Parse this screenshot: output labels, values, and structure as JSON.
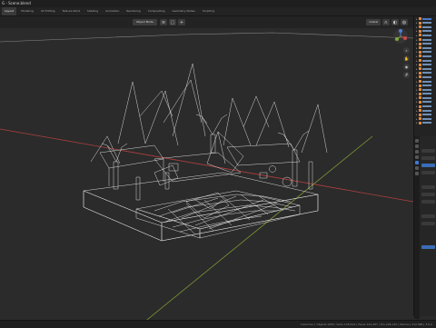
{
  "app": {
    "title": "G - Scene.blend"
  },
  "tabs": [
    "Layout",
    "Modeling",
    "UV Editing",
    "Texture Paint",
    "Shading",
    "Animation",
    "Rendering",
    "Compositing",
    "Geometry Nodes",
    "Scripting"
  ],
  "viewport": {
    "mode": "Object Mode",
    "transform_orientation": "Global",
    "colors": {
      "background": "#2b2b2b",
      "wire": "#e8e8e8",
      "x_axis": "#b0403f",
      "y_axis": "#7f9a34"
    }
  },
  "outliner": {
    "row_count": 30,
    "selected_index": 0
  },
  "statusbar": {
    "text": "Collection | Objects 0/58 | Verts 128,514 | Faces 124,307 | Tris 246,120 | Memory 312 MiB | 3.6.0"
  },
  "icons": {
    "gizmo": "navigation-gizmo-icon",
    "zoom": "zoom-icon",
    "pan": "hand-icon",
    "camera": "camera-icon",
    "grid": "grid-icon"
  }
}
